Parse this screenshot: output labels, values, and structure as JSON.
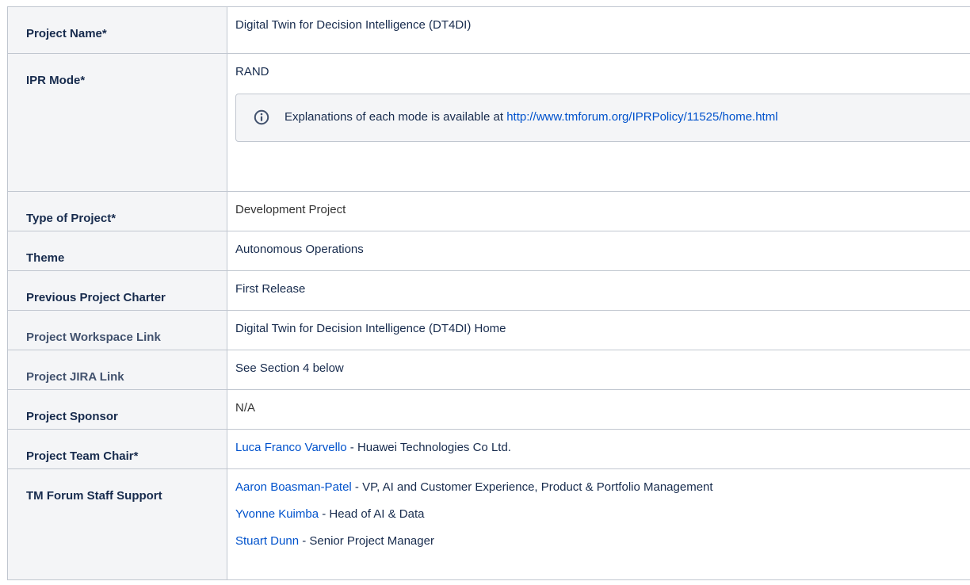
{
  "rows": [
    {
      "label": "Project Name*",
      "value": "Digital Twin for Decision Intelligence (DT4DI)"
    },
    {
      "label": "IPR Mode*",
      "value": "RAND",
      "info": {
        "icon": "info-icon",
        "text": "Explanations of each mode is available at",
        "link": "http://www.tmforum.org/IPRPolicy/11525/home.html"
      }
    },
    {
      "label": "Type of Project*",
      "value": "Development Project"
    },
    {
      "label": "Theme",
      "value": "Autonomous Operations"
    },
    {
      "label": "Previous Project Charter",
      "value": "First Release"
    },
    {
      "label": "Project Workspace Link",
      "value": "Digital Twin for Decision Intelligence (DT4DI) Home"
    },
    {
      "label": "Project JIRA Link",
      "value": "See Section 4 below"
    },
    {
      "label": "Project Sponsor",
      "value": "N/A"
    },
    {
      "label": "Project Team Chair*",
      "value": {
        "name": "Luca Franco Varvello",
        "rest": " - Huawei Technologies Co Ltd."
      }
    },
    {
      "label": "TM Forum Staff Support",
      "value": [
        {
          "name": "Aaron Boasman-Patel",
          "rest": " - VP, AI and Customer Experience, Product & Portfolio Management"
        },
        {
          "name": "Yvonne Kuimba",
          "rest": " - Head of AI & Data"
        },
        {
          "name": "Stuart Dunn",
          "rest": " - Senior Project Manager"
        }
      ]
    }
  ],
  "colors": {
    "header_bg": "#f4f5f7",
    "border": "#c1c7d0",
    "link": "#0052cc",
    "text": "#172b4d",
    "info_icon": "#42526e"
  }
}
